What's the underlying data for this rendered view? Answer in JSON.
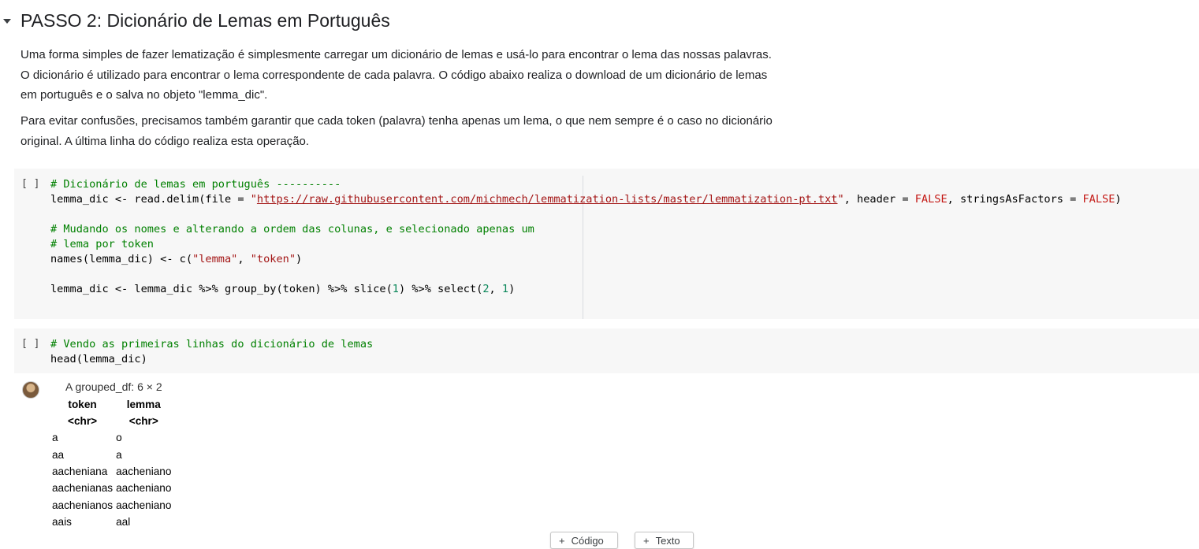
{
  "section": {
    "title": "PASSO 2: Dicionário de Lemas em Português"
  },
  "text": {
    "p1_lines": [
      "Uma forma simples de fazer lematização é simplesmente carregar um dicionário de lemas e usá-lo para encontrar o lema das nossas palavras.",
      "O dicionário é utilizado para encontrar o lema correspondente de cada palavra. O código abaixo realiza o download de um dicionário de lemas",
      "em português e o salva no objeto \"lemma_dic\"."
    ],
    "p2_lines": [
      "Para evitar confusões, precisamos também garantir que cada token (palavra) tenha apenas um lema, o que nem sempre é o caso no dicionário",
      "original. A última linha do código realiza esta operação."
    ]
  },
  "cell1": {
    "run_indicator": "[ ]",
    "comment1": "# Dicionário de lemas em português ----------",
    "l2_a": "lemma_dic <- read.delim(file = ",
    "l2_q1": "\"",
    "l2_url": "https://raw.githubusercontent.com/michmech/lemmatization-lists/master/lemmatization-pt.txt",
    "l2_q2": "\"",
    "l2_b": ", header = ",
    "l2_false1": "FALSE",
    "l2_c": ", stringsAsFactors = ",
    "l2_false2": "FALSE",
    "l2_d": ")",
    "comment2": "# Mudando os nomes e alterando a ordem das colunas, e selecionado apenas um",
    "comment3": "# lema por token",
    "l5_a": "names(lemma_dic) <- c(",
    "l5_s1": "\"lemma\"",
    "l5_b": ", ",
    "l5_s2": "\"token\"",
    "l5_c": ")",
    "l7_a": "lemma_dic <- lemma_dic %>% group_by(token) %>% slice(",
    "l7_n1": "1",
    "l7_b": ") %>% select(",
    "l7_n2": "2",
    "l7_c": ", ",
    "l7_n3": "1",
    "l7_d": ")"
  },
  "cell2": {
    "run_indicator": "[ ]",
    "comment": "# Vendo as primeiras linhas do dicionário de lemas",
    "line2": "head(lemma_dic)"
  },
  "output": {
    "caption": "A grouped_df: 6 × 2",
    "headers": [
      "token",
      "lemma"
    ],
    "types": [
      "<chr>",
      "<chr>"
    ],
    "rows": [
      [
        "a",
        "o"
      ],
      [
        "aa",
        "a"
      ],
      [
        "aacheniana",
        "aacheniano"
      ],
      [
        "aachenianas",
        "aacheniano"
      ],
      [
        "aachenianos",
        "aacheniano"
      ],
      [
        "aais",
        "aal"
      ]
    ]
  },
  "toolbar": {
    "add_code": "Código",
    "add_text": "Texto",
    "plus": "+"
  }
}
